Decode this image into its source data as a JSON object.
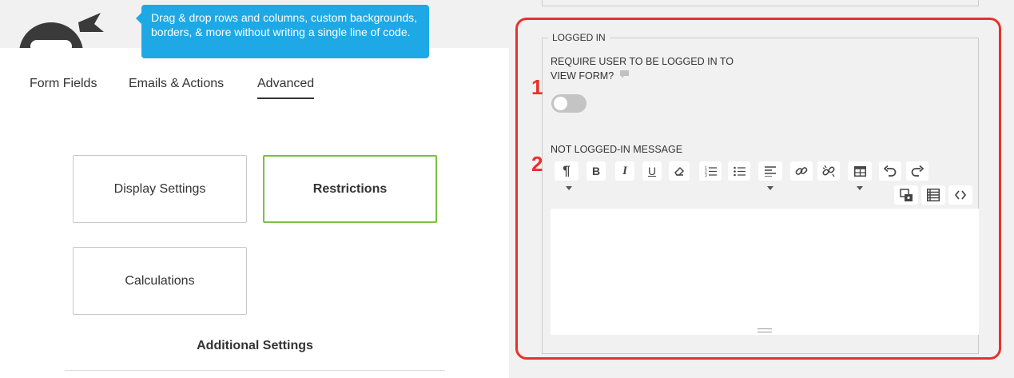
{
  "tooltip": {
    "text": "Drag & drop rows and columns, custom backgrounds, borders, & more without writing a single line of code."
  },
  "tabs": [
    {
      "label": "Form Fields"
    },
    {
      "label": "Emails & Actions"
    },
    {
      "label": "Advanced",
      "active": true
    }
  ],
  "cards": {
    "display": "Display Settings",
    "restrictions": "Restrictions",
    "calculations": "Calculations"
  },
  "additional_settings": "Additional Settings",
  "panel": {
    "legend": "LOGGED IN",
    "callouts": [
      "1",
      "2"
    ],
    "require_label": "REQUIRE USER TO BE LOGGED IN TO VIEW FORM?",
    "toggle_on": false,
    "message_label": "NOT LOGGED-IN MESSAGE"
  },
  "toolbar_icons": [
    "paragraph-icon",
    "bold-icon",
    "italic-icon",
    "underline-icon",
    "eraser-icon",
    "ordered-list-icon",
    "unordered-list-icon",
    "align-left-icon",
    "link-icon",
    "unlink-icon",
    "table-icon",
    "undo-icon",
    "redo-icon",
    "media-icon",
    "content-icon",
    "code-icon"
  ],
  "colors": {
    "accent_green": "#7bc143",
    "tooltip_blue": "#1ea9e6",
    "callout_red": "#e8312b"
  }
}
